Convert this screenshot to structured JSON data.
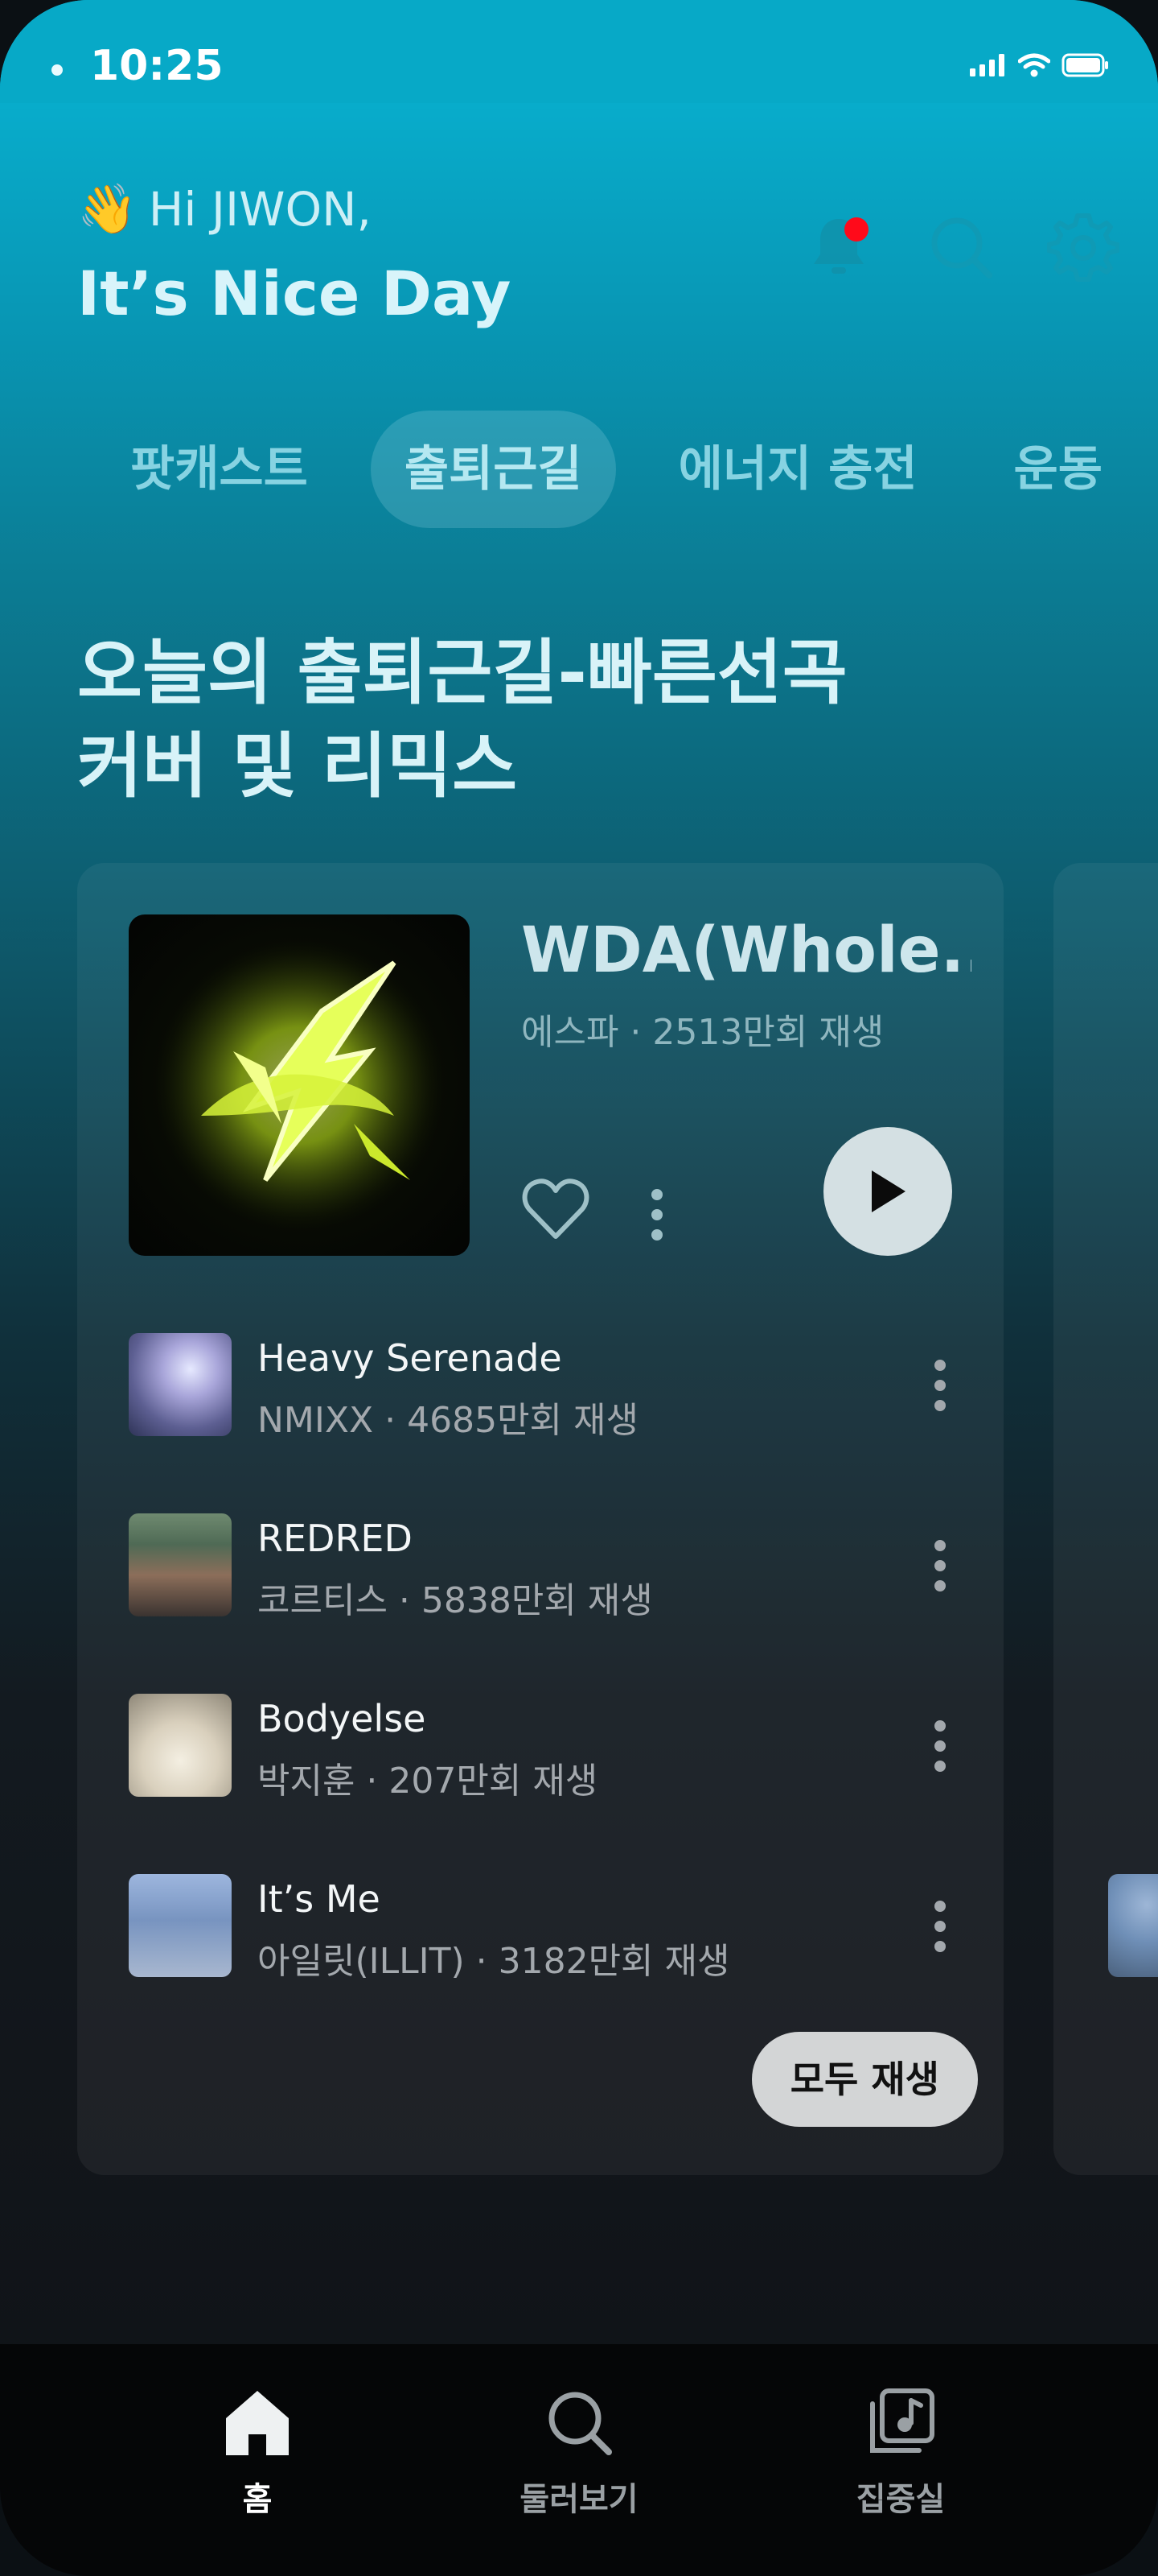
{
  "status_bar": {
    "time": "10:25"
  },
  "header": {
    "greeting_emoji": "👋",
    "greeting": "Hi JIWON,",
    "subtitle": "It’s Nice Day",
    "notification_badge": true
  },
  "tabs": [
    {
      "label": "팟캐스트",
      "active": false
    },
    {
      "label": "출퇴근길",
      "active": true
    },
    {
      "label": "에너지 충전",
      "active": false
    },
    {
      "label": "운동",
      "active": false
    }
  ],
  "section": {
    "title_line1": "오늘의 출퇴근길-빠른선곡",
    "title_line2": "커버 및 리믹스"
  },
  "featured": {
    "title": "WDA(Whole..",
    "artist_plays": "에스파 · 2513만회 재생"
  },
  "tracks": [
    {
      "title": "Heavy Serenade",
      "sub": "NMIXX · 4685만회 재생"
    },
    {
      "title": "REDRED",
      "sub": "코르티스 · 5838만회 재생"
    },
    {
      "title": "Bodyelse",
      "sub": "박지훈 · 207만회 재생"
    },
    {
      "title": "It’s Me",
      "sub": "아일릿(ILLIT) · 3182만회 재생"
    }
  ],
  "play_all_label": "모두 재생",
  "bottom_nav": [
    {
      "label": "홈",
      "icon": "home-icon",
      "active": true
    },
    {
      "label": "둘러보기",
      "icon": "search-icon",
      "active": false
    },
    {
      "label": "집중실",
      "icon": "library-icon",
      "active": false
    }
  ],
  "colors": {
    "accent_top": "#08b6d6",
    "notification": "#ff0a1a",
    "background_bottom": "#0f1216"
  }
}
